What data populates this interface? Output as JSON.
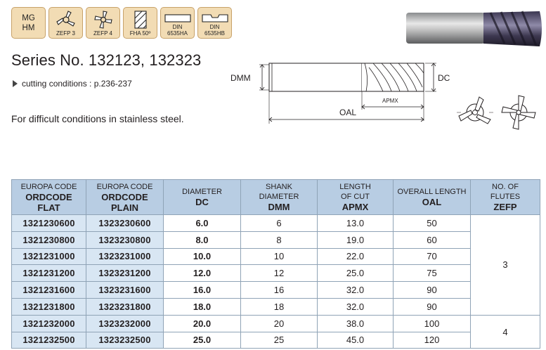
{
  "badges": [
    {
      "type": "text",
      "lines": [
        "MG",
        "HM"
      ]
    },
    {
      "type": "icon",
      "icon": "zefp3-icon",
      "label": "ZEFP 3"
    },
    {
      "type": "icon",
      "icon": "zefp4-icon",
      "label": "ZEFP 4"
    },
    {
      "type": "icon",
      "icon": "fha-icon",
      "label": "FHA 50º"
    },
    {
      "type": "icon",
      "icon": "din-6535ha-icon",
      "top": "DIN",
      "label": "6535HA"
    },
    {
      "type": "icon",
      "icon": "din-6535hb-icon",
      "top": "DIN",
      "label": "6535HB"
    }
  ],
  "title": "Series No. 132123, 132323",
  "cutting_conditions": "cutting conditions : p.236-237",
  "description": "For difficult conditions in stainless steel.",
  "drawing": {
    "dmm": "DMM",
    "dc": "DC",
    "apmx": "APMX",
    "oal": "OAL"
  },
  "table": {
    "headers": [
      {
        "top": "EUROPA CODE",
        "bold1": "ORDCODE",
        "bold2": "FLAT"
      },
      {
        "top": "EUROPA CODE",
        "bold1": "ORDCODE",
        "bold2": "PLAIN"
      },
      {
        "top": "DIAMETER",
        "bold1": "DC"
      },
      {
        "top": "SHANK",
        "top2": "DIAMETER",
        "bold1": "DMM"
      },
      {
        "top": "LENGTH",
        "top2": "OF CUT",
        "bold1": "APMX"
      },
      {
        "top": "OVERALL LENGTH",
        "bold1": "OAL"
      },
      {
        "top": "NO. OF",
        "top2": "FLUTES",
        "bold1": "ZEFP"
      }
    ],
    "rows": [
      {
        "flat": "1321230600",
        "plain": "1323230600",
        "dc": "6.0",
        "dmm": "6",
        "apmx": "13.0",
        "oal": "50"
      },
      {
        "flat": "1321230800",
        "plain": "1323230800",
        "dc": "8.0",
        "dmm": "8",
        "apmx": "19.0",
        "oal": "60"
      },
      {
        "flat": "1321231000",
        "plain": "1323231000",
        "dc": "10.0",
        "dmm": "10",
        "apmx": "22.0",
        "oal": "70"
      },
      {
        "flat": "1321231200",
        "plain": "1323231200",
        "dc": "12.0",
        "dmm": "12",
        "apmx": "25.0",
        "oal": "75"
      },
      {
        "flat": "1321231600",
        "plain": "1323231600",
        "dc": "16.0",
        "dmm": "16",
        "apmx": "32.0",
        "oal": "90"
      },
      {
        "flat": "1321231800",
        "plain": "1323231800",
        "dc": "18.0",
        "dmm": "18",
        "apmx": "32.0",
        "oal": "90"
      },
      {
        "flat": "1321232000",
        "plain": "1323232000",
        "dc": "20.0",
        "dmm": "20",
        "apmx": "38.0",
        "oal": "100"
      },
      {
        "flat": "1321232500",
        "plain": "1323232500",
        "dc": "25.0",
        "dmm": "25",
        "apmx": "45.0",
        "oal": "120"
      }
    ],
    "flute_groups": [
      {
        "value": "3",
        "span": 6
      },
      {
        "value": "4",
        "span": 2
      }
    ]
  },
  "colors": {
    "header_bg": "#b8cde3",
    "code_bg": "#d8e6f3",
    "badge_bg": "#f2dcb4",
    "border": "#8fa3b6"
  }
}
